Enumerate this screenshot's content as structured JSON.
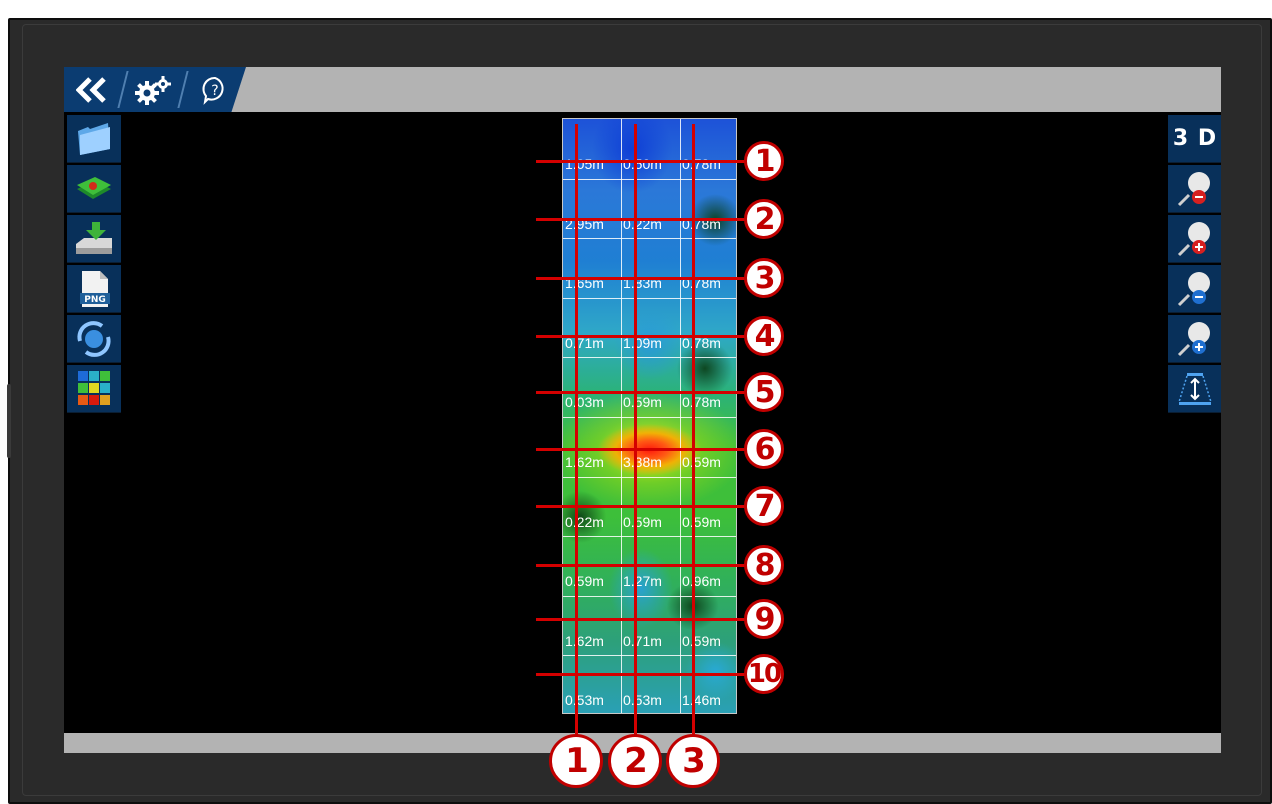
{
  "toolbar": {
    "back_icon": "double-chevron-left-icon",
    "settings_icon": "gears-icon",
    "help_icon": "question-circle-icon"
  },
  "left_tools": [
    {
      "name": "open-folder-button",
      "icon": "folder-icon"
    },
    {
      "name": "map-layer-button",
      "icon": "map-layers-icon"
    },
    {
      "name": "save-to-drive-button",
      "icon": "download-drive-icon"
    },
    {
      "name": "export-png-button",
      "icon": "png-file-icon",
      "label": "PNG"
    },
    {
      "name": "rotate-view-button",
      "icon": "rotate-globe-icon"
    },
    {
      "name": "color-grid-button",
      "icon": "color-grid-icon"
    }
  ],
  "right_tools": {
    "view_3d_label": "3 D",
    "items": [
      {
        "name": "zoom-out-horizontal-button",
        "icon": "magnifier-minus-icon"
      },
      {
        "name": "zoom-in-horizontal-button",
        "icon": "magnifier-plus-icon"
      },
      {
        "name": "zoom-out-vertical-button",
        "icon": "magnifier-minus-icon"
      },
      {
        "name": "zoom-in-vertical-button",
        "icon": "magnifier-plus-icon"
      },
      {
        "name": "depth-scale-button",
        "icon": "depth-arrow-icon"
      }
    ]
  },
  "grid": {
    "rows": [
      [
        "1.05m",
        "0.50m",
        "0.78m"
      ],
      [
        "2.95m",
        "0.22m",
        "0.78m"
      ],
      [
        "1.65m",
        "1.83m",
        "0.78m"
      ],
      [
        "0.71m",
        "1.09m",
        "0.78m"
      ],
      [
        "0.03m",
        "0.59m",
        "0.78m"
      ],
      [
        "1.62m",
        "3.38m",
        "0.59m"
      ],
      [
        "0.22m",
        "0.59m",
        "0.59m"
      ],
      [
        "0.59m",
        "1.27m",
        "0.96m"
      ],
      [
        "1.62m",
        "0.71m",
        "0.59m"
      ],
      [
        "0.53m",
        "0.53m",
        "1.46m"
      ]
    ]
  },
  "row_markers": [
    "1",
    "2",
    "3",
    "4",
    "5",
    "6",
    "7",
    "8",
    "9",
    "10"
  ],
  "column_markers": [
    "1",
    "2",
    "3"
  ],
  "colors": {
    "tool_bg": "#08305a",
    "tab_bg": "#0b3c71",
    "bar_gray": "#b3b3b3",
    "marker_red": "#c00000"
  }
}
